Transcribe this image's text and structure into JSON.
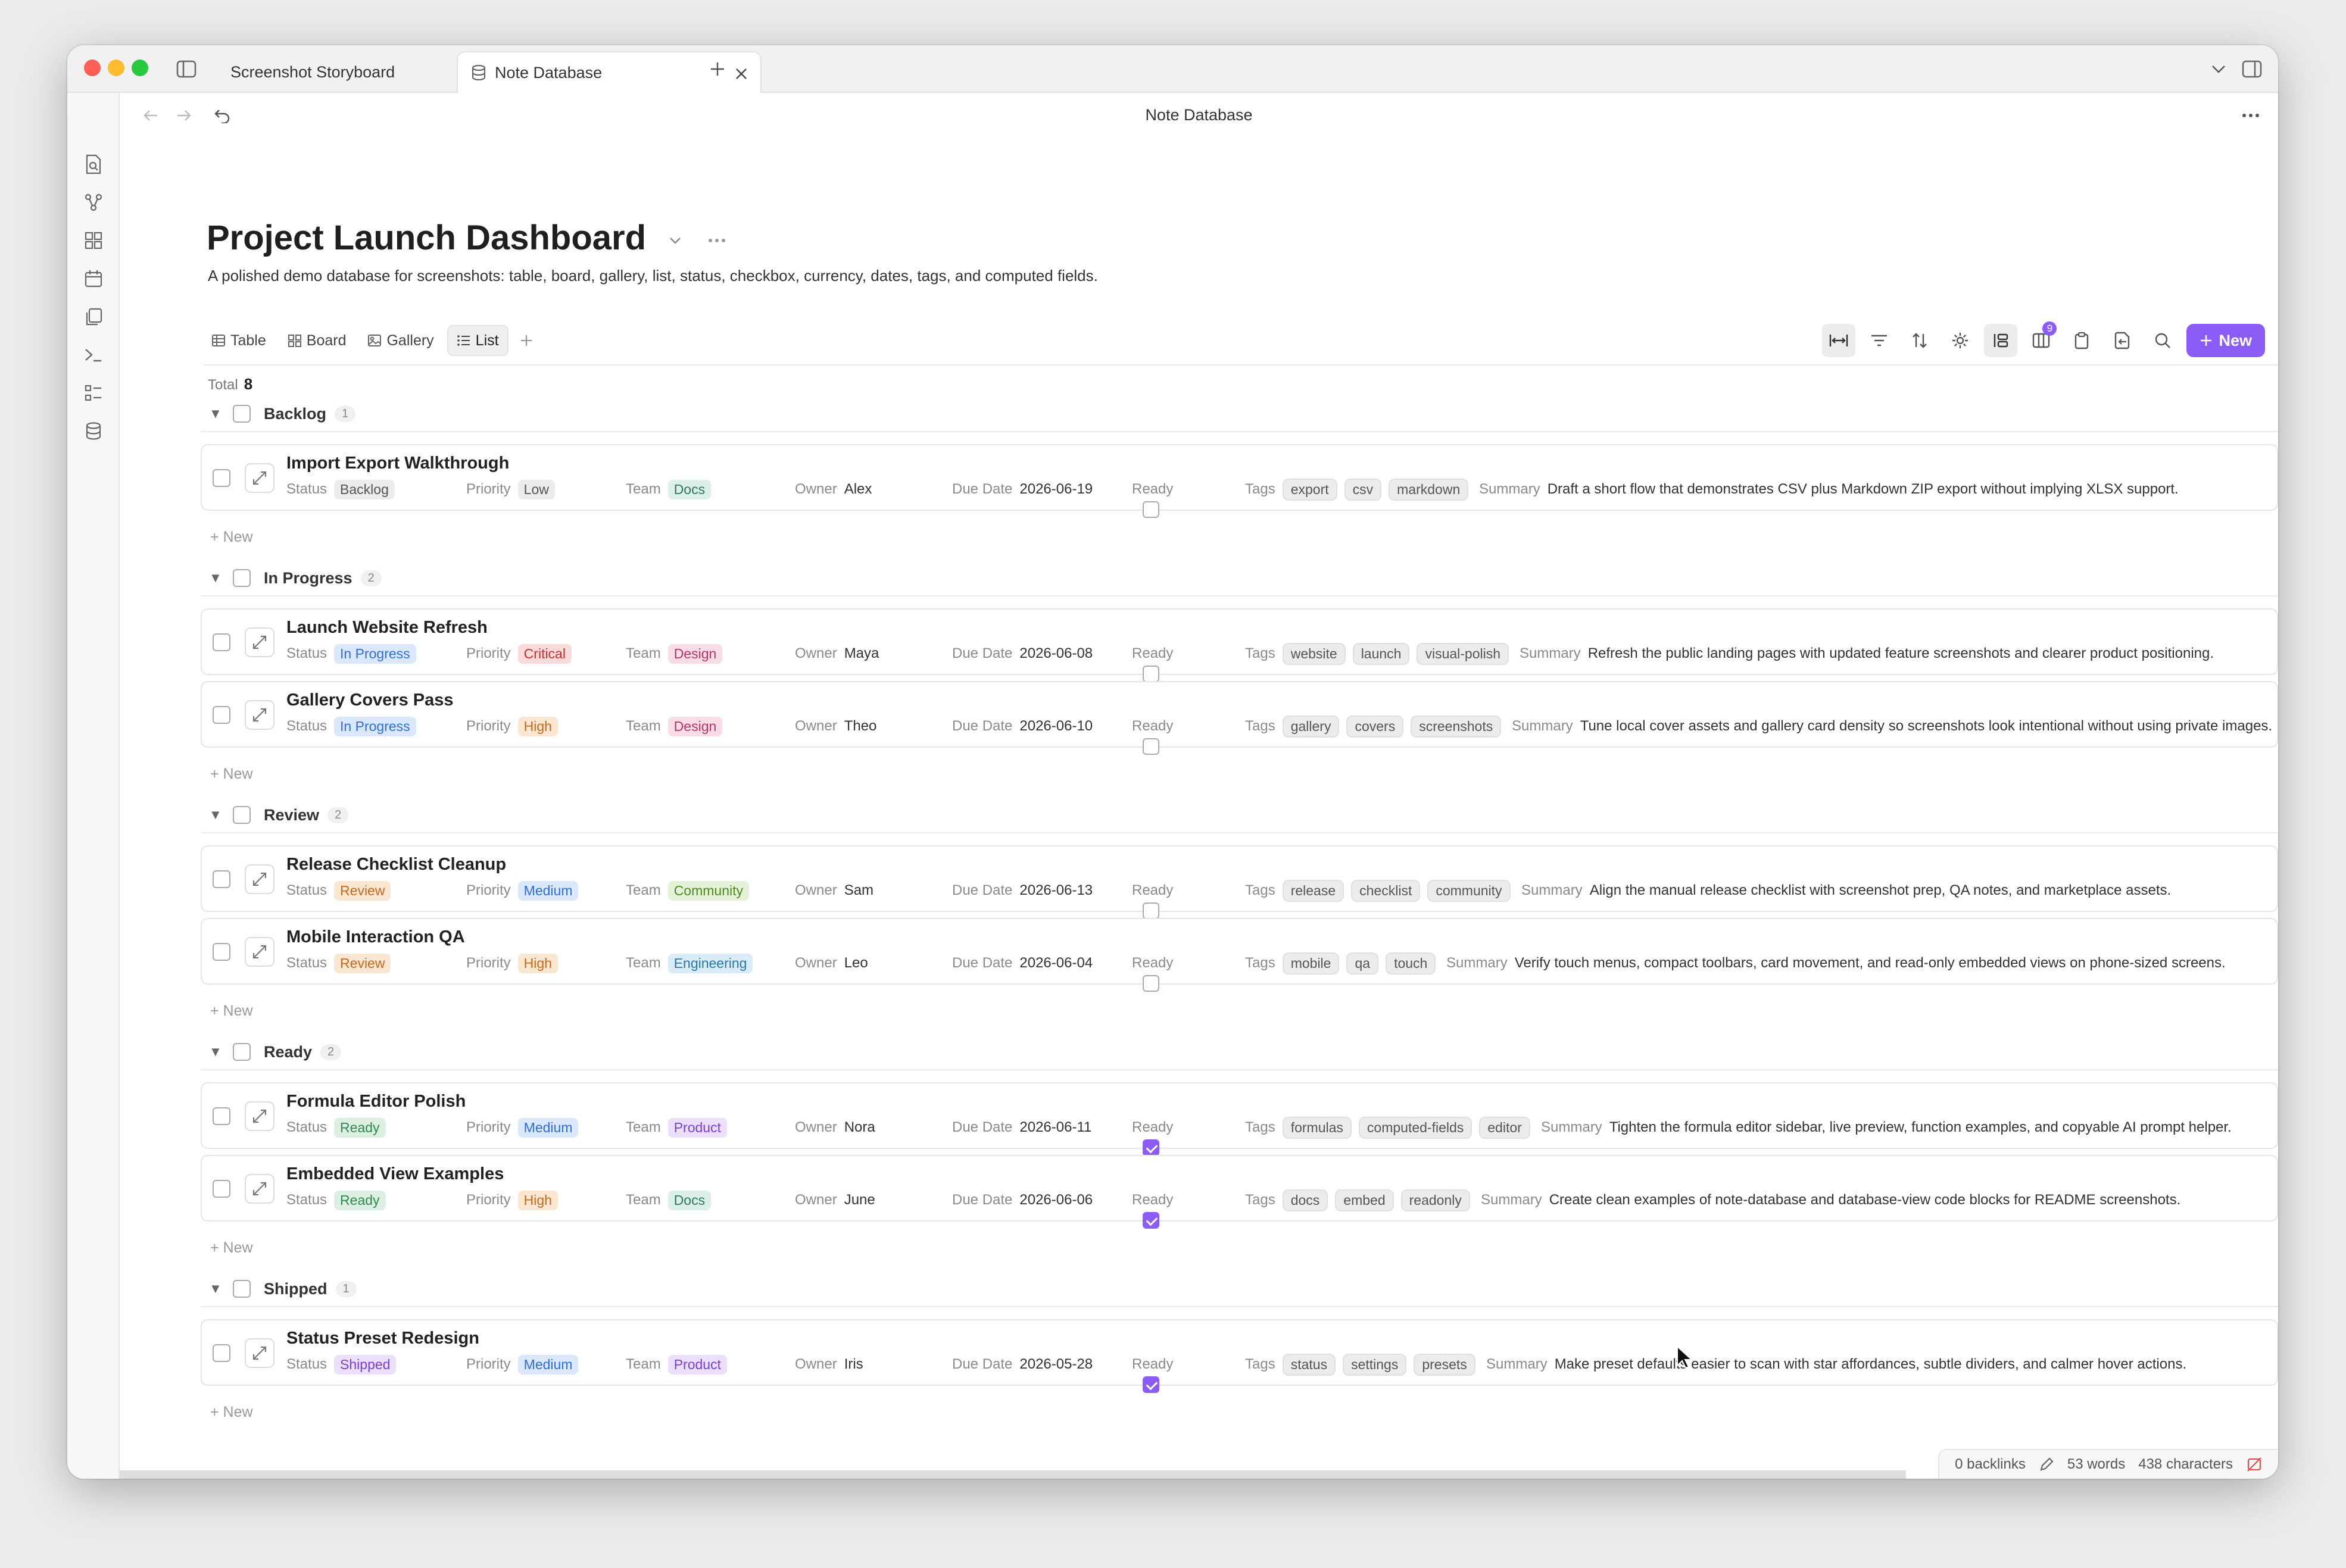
{
  "window": {
    "tabs": [
      {
        "label": "Screenshot Storyboard",
        "active": false
      },
      {
        "label": "Note Database",
        "active": true
      }
    ]
  },
  "navbar": {
    "title": "Note Database"
  },
  "page": {
    "title": "Project Launch Dashboard",
    "description": "A polished demo database for screenshots: table, board, gallery, list, status, checkbox, currency, dates, tags, and computed fields."
  },
  "views": [
    {
      "label": "Table",
      "icon": "table-icon"
    },
    {
      "label": "Board",
      "icon": "board-icon"
    },
    {
      "label": "Gallery",
      "icon": "gallery-icon"
    },
    {
      "label": "List",
      "icon": "list-icon",
      "active": true
    }
  ],
  "toolbar": {
    "new_label": "New",
    "columns_badge": "9"
  },
  "total": {
    "label": "Total",
    "value": "8"
  },
  "props_labels": {
    "status": "Status",
    "priority": "Priority",
    "team": "Team",
    "owner": "Owner",
    "due": "Due Date",
    "ready": "Ready",
    "tags": "Tags",
    "summary": "Summary"
  },
  "add_new_label": "+ New",
  "colors": {
    "accent": "#8b5cf6",
    "status": {
      "Backlog": [
        "#ececec",
        "#555555"
      ],
      "In Progress": [
        "#dbe8fb",
        "#2f6fd6"
      ],
      "Review": [
        "#fbe6d2",
        "#c46a1e"
      ],
      "Ready": [
        "#dcefe2",
        "#2f8a4e"
      ],
      "Shipped": [
        "#ebe0fb",
        "#7a3fd6"
      ]
    },
    "priority": {
      "Low": [
        "#ececec",
        "#555555"
      ],
      "Critical": [
        "#fadada",
        "#c62f2f"
      ],
      "High": [
        "#fbe6d2",
        "#c46a1e"
      ],
      "Medium": [
        "#dbe8fb",
        "#2f6fd6"
      ]
    },
    "team": {
      "Docs": [
        "#dcefe8",
        "#2b7a5e"
      ],
      "Design": [
        "#f9dde6",
        "#b3366a"
      ],
      "Community": [
        "#e5f2d8",
        "#4e8a22"
      ],
      "Engineering": [
        "#d9ecf7",
        "#2a78a8"
      ],
      "Product": [
        "#ebe0fb",
        "#7a3fd6"
      ]
    }
  },
  "groups": [
    {
      "name": "Backlog",
      "count": "1",
      "items": [
        {
          "title": "Import Export Walkthrough",
          "status": "Backlog",
          "priority": "Low",
          "team": "Docs",
          "owner": "Alex",
          "due": "2026-06-19",
          "ready": false,
          "tags": [
            "export",
            "csv",
            "markdown"
          ],
          "summary": "Draft a short flow that demonstrates CSV plus Markdown ZIP export without implying XLSX support."
        }
      ]
    },
    {
      "name": "In Progress",
      "count": "2",
      "items": [
        {
          "title": "Launch Website Refresh",
          "status": "In Progress",
          "priority": "Critical",
          "team": "Design",
          "owner": "Maya",
          "due": "2026-06-08",
          "ready": false,
          "tags": [
            "website",
            "launch",
            "visual-polish"
          ],
          "summary": "Refresh the public landing pages with updated feature screenshots and clearer product positioning."
        },
        {
          "title": "Gallery Covers Pass",
          "status": "In Progress",
          "priority": "High",
          "team": "Design",
          "owner": "Theo",
          "due": "2026-06-10",
          "ready": false,
          "tags": [
            "gallery",
            "covers",
            "screenshots"
          ],
          "summary": "Tune local cover assets and gallery card density so screenshots look intentional without using private images."
        }
      ]
    },
    {
      "name": "Review",
      "count": "2",
      "items": [
        {
          "title": "Release Checklist Cleanup",
          "status": "Review",
          "priority": "Medium",
          "team": "Community",
          "owner": "Sam",
          "due": "2026-06-13",
          "ready": false,
          "tags": [
            "release",
            "checklist",
            "community"
          ],
          "summary": "Align the manual release checklist with screenshot prep, QA notes, and marketplace assets."
        },
        {
          "title": "Mobile Interaction QA",
          "status": "Review",
          "priority": "High",
          "team": "Engineering",
          "owner": "Leo",
          "due": "2026-06-04",
          "ready": false,
          "tags": [
            "mobile",
            "qa",
            "touch"
          ],
          "summary": "Verify touch menus, compact toolbars, card movement, and read-only embedded views on phone-sized screens."
        }
      ]
    },
    {
      "name": "Ready",
      "count": "2",
      "items": [
        {
          "title": "Formula Editor Polish",
          "status": "Ready",
          "priority": "Medium",
          "team": "Product",
          "owner": "Nora",
          "due": "2026-06-11",
          "ready": true,
          "tags": [
            "formulas",
            "computed-fields",
            "editor"
          ],
          "summary": "Tighten the formula editor sidebar, live preview, function examples, and copyable AI prompt helper."
        },
        {
          "title": "Embedded View Examples",
          "status": "Ready",
          "priority": "High",
          "team": "Docs",
          "owner": "June",
          "due": "2026-06-06",
          "ready": true,
          "tags": [
            "docs",
            "embed",
            "readonly"
          ],
          "summary": "Create clean examples of note-database and database-view code blocks for README screenshots."
        }
      ]
    },
    {
      "name": "Shipped",
      "count": "1",
      "items": [
        {
          "title": "Status Preset Redesign",
          "status": "Shipped",
          "priority": "Medium",
          "team": "Product",
          "owner": "Iris",
          "due": "2026-05-28",
          "ready": true,
          "tags": [
            "status",
            "settings",
            "presets"
          ],
          "summary": "Make preset defaults easier to scan with star affordances, subtle dividers, and calmer hover actions."
        }
      ]
    }
  ],
  "statusbar": {
    "backlinks": "0 backlinks",
    "words": "53 words",
    "characters": "438 characters"
  }
}
